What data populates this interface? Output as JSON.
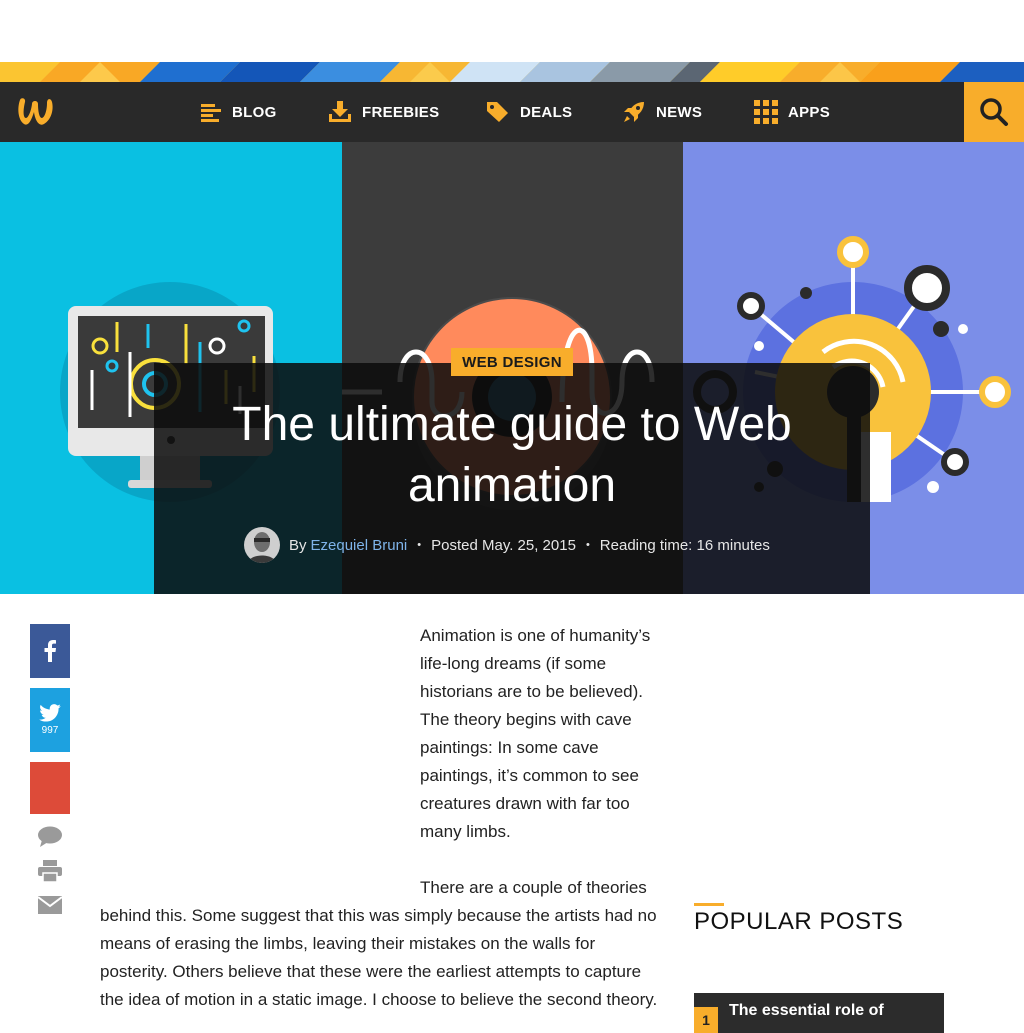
{
  "nav": {
    "items": [
      {
        "label": "BLOG",
        "icon": "blog-icon"
      },
      {
        "label": "FREEBIES",
        "icon": "download-icon"
      },
      {
        "label": "DEALS",
        "icon": "tag-icon"
      },
      {
        "label": "NEWS",
        "icon": "rocket-icon"
      },
      {
        "label": "APPS",
        "icon": "apps-grid-icon"
      }
    ],
    "search_icon": "search-icon",
    "logo_icon": "webdesigner-depot-logo"
  },
  "hero": {
    "category": "WEB DESIGN",
    "title": "The ultimate guide to Web animation",
    "by_label": "By",
    "author": "Ezequiel Bruni",
    "posted": "Posted May. 25, 2015",
    "reading_time": "Reading time: 16 minutes",
    "separator": "•"
  },
  "share": {
    "facebook_icon": "facebook-icon",
    "twitter_icon": "twitter-icon",
    "twitter_count": "997",
    "googleplus_icon": "google-plus-icon",
    "comment_icon": "comment-icon",
    "print_icon": "print-icon",
    "email_icon": "email-icon"
  },
  "article": {
    "paragraph1": "Animation is one of humanity’s life-long dreams (if some historians are to be believed). The theory begins with cave paintings: In some cave paintings, it’s common to see creatures drawn with far too many limbs.",
    "paragraph2": "There are a couple of theories behind this. Some suggest that this was simply because the artists had no means of erasing the limbs, leaving their mistakes on the walls for posterity. Others believe that these were the earliest attempts to capture the idea of motion in a static image. I choose to believe the second theory."
  },
  "sidebar": {
    "popular_title": "POPULAR POSTS",
    "first_post_number": "1",
    "first_post_title": "The essential role of"
  },
  "colors": {
    "accent": "#f8ad2b",
    "navbar": "#292929",
    "hero_cyan": "#0ac0e2",
    "hero_dark": "#3c3c3c",
    "hero_blue": "#7b8ee8",
    "facebook": "#3b5998",
    "twitter": "#1da1e0",
    "googleplus": "#dd4b39",
    "author_link": "#7fb4ea"
  }
}
